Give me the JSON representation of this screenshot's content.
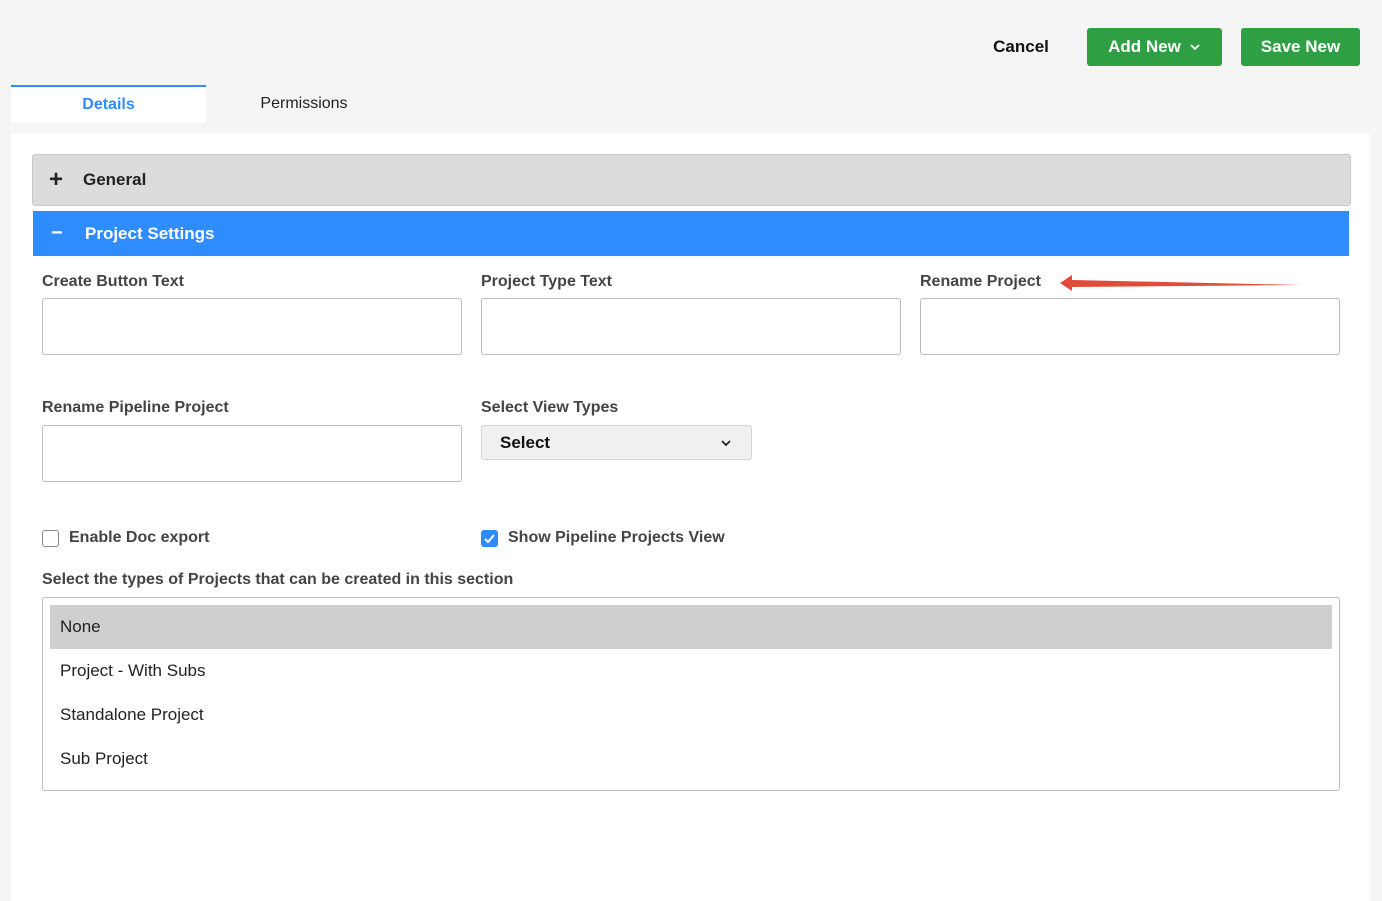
{
  "toolbar": {
    "cancel_label": "Cancel",
    "add_new_label": "Add New",
    "save_new_label": "Save New"
  },
  "tabs": [
    {
      "label": "Details",
      "active": true
    },
    {
      "label": "Permissions",
      "active": false
    }
  ],
  "sections": {
    "general": {
      "sign": "+",
      "title": "General"
    },
    "project_settings": {
      "sign": "−",
      "title": "Project Settings"
    }
  },
  "fields": {
    "create_button_text": {
      "label": "Create Button Text",
      "value": ""
    },
    "project_type_text": {
      "label": "Project Type Text",
      "value": ""
    },
    "rename_project": {
      "label": "Rename Project",
      "value": ""
    },
    "rename_pipeline_project": {
      "label": "Rename Pipeline Project",
      "value": ""
    },
    "select_view_types": {
      "label": "Select View Types",
      "value": "Select"
    }
  },
  "checkboxes": {
    "enable_doc_export": {
      "label": "Enable Doc export",
      "checked": false
    },
    "show_pipeline_projects_view": {
      "label": "Show Pipeline Projects View",
      "checked": true
    }
  },
  "project_types": {
    "label": "Select the types of Projects that can be created in this section",
    "options": [
      "None",
      "Project - With Subs",
      "Standalone Project",
      "Sub Project"
    ],
    "selected": "None"
  },
  "colors": {
    "accent": "#2f8cff",
    "button_green": "#2ea043",
    "annotation_arrow": "#e04b3a"
  },
  "icons": {
    "add_new_dropdown": "chevron-down-icon",
    "select_dropdown": "chevron-down-icon",
    "checkbox_check": "check-icon",
    "annotation": "red-arrow-icon"
  }
}
